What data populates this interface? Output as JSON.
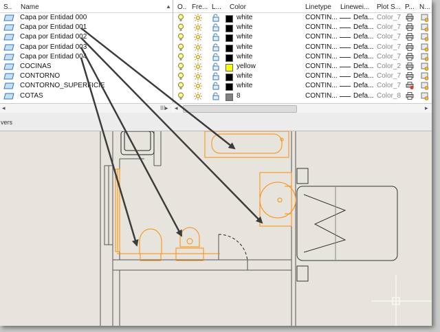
{
  "left_headers": {
    "status": "S..",
    "name": "Name"
  },
  "layers": [
    {
      "name": "Capa por Entidad 000",
      "on": true,
      "color_name": "white",
      "color_hex": "#000000",
      "linetype": "CONTIN...",
      "lineweight": "Defa...",
      "plot_style": "Color_7",
      "plot": "print",
      "new_vp": "freeze"
    },
    {
      "name": "Capa por Entidad 001",
      "on": true,
      "color_name": "white",
      "color_hex": "#000000",
      "linetype": "CONTIN...",
      "lineweight": "Defa...",
      "plot_style": "Color_7",
      "plot": "print",
      "new_vp": "freeze"
    },
    {
      "name": "Capa por Entidad 002",
      "on": true,
      "color_name": "white",
      "color_hex": "#000000",
      "linetype": "CONTIN...",
      "lineweight": "Defa...",
      "plot_style": "Color_7",
      "plot": "print",
      "new_vp": "freeze"
    },
    {
      "name": "Capa por Entidad 003",
      "on": true,
      "color_name": "white",
      "color_hex": "#000000",
      "linetype": "CONTIN...",
      "lineweight": "Defa...",
      "plot_style": "Color_7",
      "plot": "print",
      "new_vp": "freeze"
    },
    {
      "name": "Capa por Entidad 004",
      "on": true,
      "color_name": "white",
      "color_hex": "#000000",
      "linetype": "CONTIN...",
      "lineweight": "Defa...",
      "plot_style": "Color_7",
      "plot": "print",
      "new_vp": "freeze"
    },
    {
      "name": "COCINAS",
      "on": true,
      "color_name": "yellow",
      "color_hex": "#ffff00",
      "linetype": "CONTIN...",
      "lineweight": "Defa...",
      "plot_style": "Color_2",
      "plot": "print",
      "new_vp": "freeze"
    },
    {
      "name": "CONTORNO",
      "on": true,
      "color_name": "white",
      "color_hex": "#000000",
      "linetype": "CONTIN...",
      "lineweight": "Defa...",
      "plot_style": "Color_7",
      "plot": "print",
      "new_vp": "freeze"
    },
    {
      "name": "CONTORNO_SUPERFICIE",
      "on": true,
      "color_name": "white",
      "color_hex": "#000000",
      "linetype": "CONTIN...",
      "lineweight": "Defa...",
      "plot_style": "Color_7",
      "plot": "noprint",
      "new_vp": "freeze"
    },
    {
      "name": "COTAS",
      "on": true,
      "color_name": "8",
      "color_hex": "#808080",
      "linetype": "CONTIN...",
      "lineweight": "Defa...",
      "plot_style": "Color_8",
      "plot": "print",
      "new_vp": "freeze"
    }
  ],
  "right_headers": {
    "on": "O..",
    "freeze": "Fre...",
    "lock": "L...",
    "color": "Color",
    "linetype": "Linetype",
    "lineweight": "Linewei...",
    "plot_style": "Plot S...",
    "plot": "P...",
    "new_vp": "N..."
  },
  "status_text": "vers",
  "colors": {
    "drawing_bg": "#e6e4dc",
    "accent_orange": "#ff8c00",
    "wall": "#555555",
    "arrow": "#3c3c3c",
    "selection": "#cfe6f7"
  }
}
